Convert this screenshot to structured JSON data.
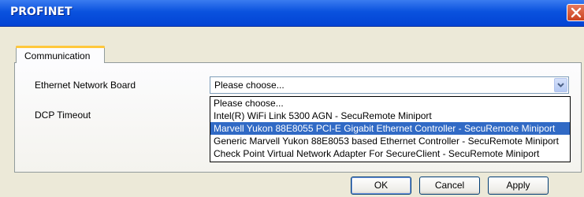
{
  "window": {
    "title": "PROFINET"
  },
  "tabs": [
    {
      "label": "Communication"
    }
  ],
  "form": {
    "ethernet_board_label": "Ethernet Network Board",
    "dcp_timeout_label": "DCP Timeout",
    "ethernet_board_value": "Please choose..."
  },
  "dropdown": {
    "options": [
      "Please choose...",
      "Intel(R) WiFi Link 5300 AGN - SecuRemote Miniport",
      "Marvell Yukon 88E8055 PCI-E Gigabit Ethernet Controller - SecuRemote Miniport",
      "Generic Marvell Yukon 88E8053 based Ethernet Controller - SecuRemote Miniport",
      "Check Point Virtual Network Adapter For SecureClient - SecuRemote Miniport"
    ],
    "selected_index": 2
  },
  "buttons": {
    "ok": "OK",
    "cancel": "Cancel",
    "apply": "Apply"
  },
  "icons": {
    "close": "close-icon",
    "dropdown": "chevron-down-icon"
  },
  "colors": {
    "titlebar": "#0a52de",
    "selection": "#316ac5",
    "close_button": "#c9421f"
  }
}
